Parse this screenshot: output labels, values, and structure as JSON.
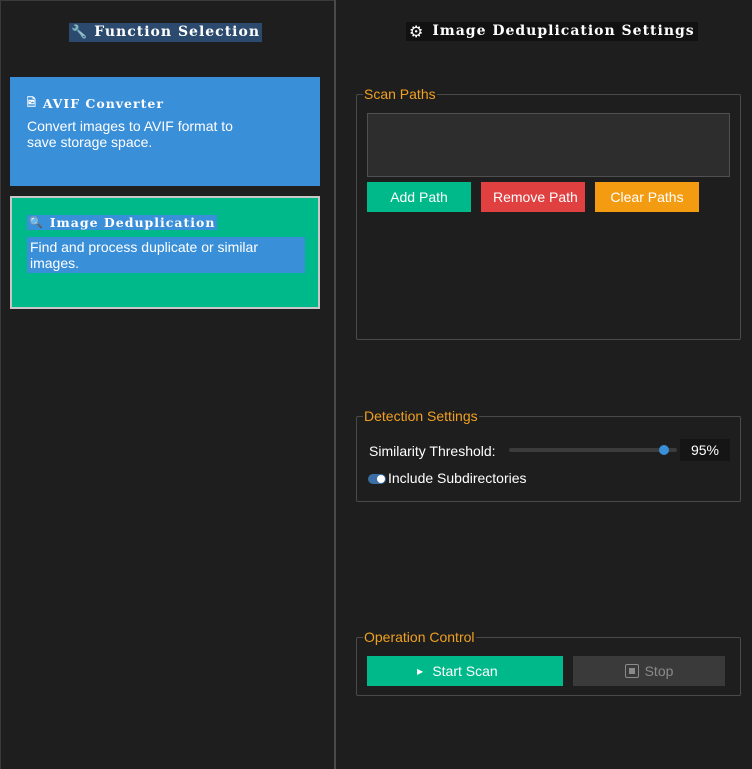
{
  "left_panel": {
    "title": "Function Selection",
    "title_icon": "wrench-icon",
    "cards": [
      {
        "title": "AVIF Converter",
        "icon": "image-file-icon",
        "description": "Convert images to AVIF format to save storage space.",
        "color": "#3a8fd9"
      },
      {
        "title": "Image Deduplication",
        "icon": "magnifier-icon",
        "description": "Find and process duplicate or similar images.",
        "color": "#00b98a",
        "selected": true
      }
    ]
  },
  "right_panel": {
    "title": "Image Deduplication Settings",
    "title_icon": "film-reel-icon",
    "scan_paths": {
      "legend": "Scan Paths",
      "paths": [],
      "add_label": "Add Path",
      "remove_label": "Remove Path",
      "clear_label": "Clear Paths"
    },
    "detection": {
      "legend": "Detection Settings",
      "threshold_label": "Similarity Threshold:",
      "threshold_value": "95%",
      "threshold_fraction": 0.95,
      "include_subdirs_label": "Include Subdirectories",
      "include_subdirs": true
    },
    "operation": {
      "legend": "Operation Control",
      "start_label": "Start Scan",
      "stop_label": "Stop"
    }
  },
  "colors": {
    "accent_green": "#00b98a",
    "accent_blue": "#3a8fd9",
    "danger_red": "#e04040",
    "warning_orange": "#f39c12",
    "legend_orange": "#f0a020",
    "background": "#1e1e1e"
  }
}
